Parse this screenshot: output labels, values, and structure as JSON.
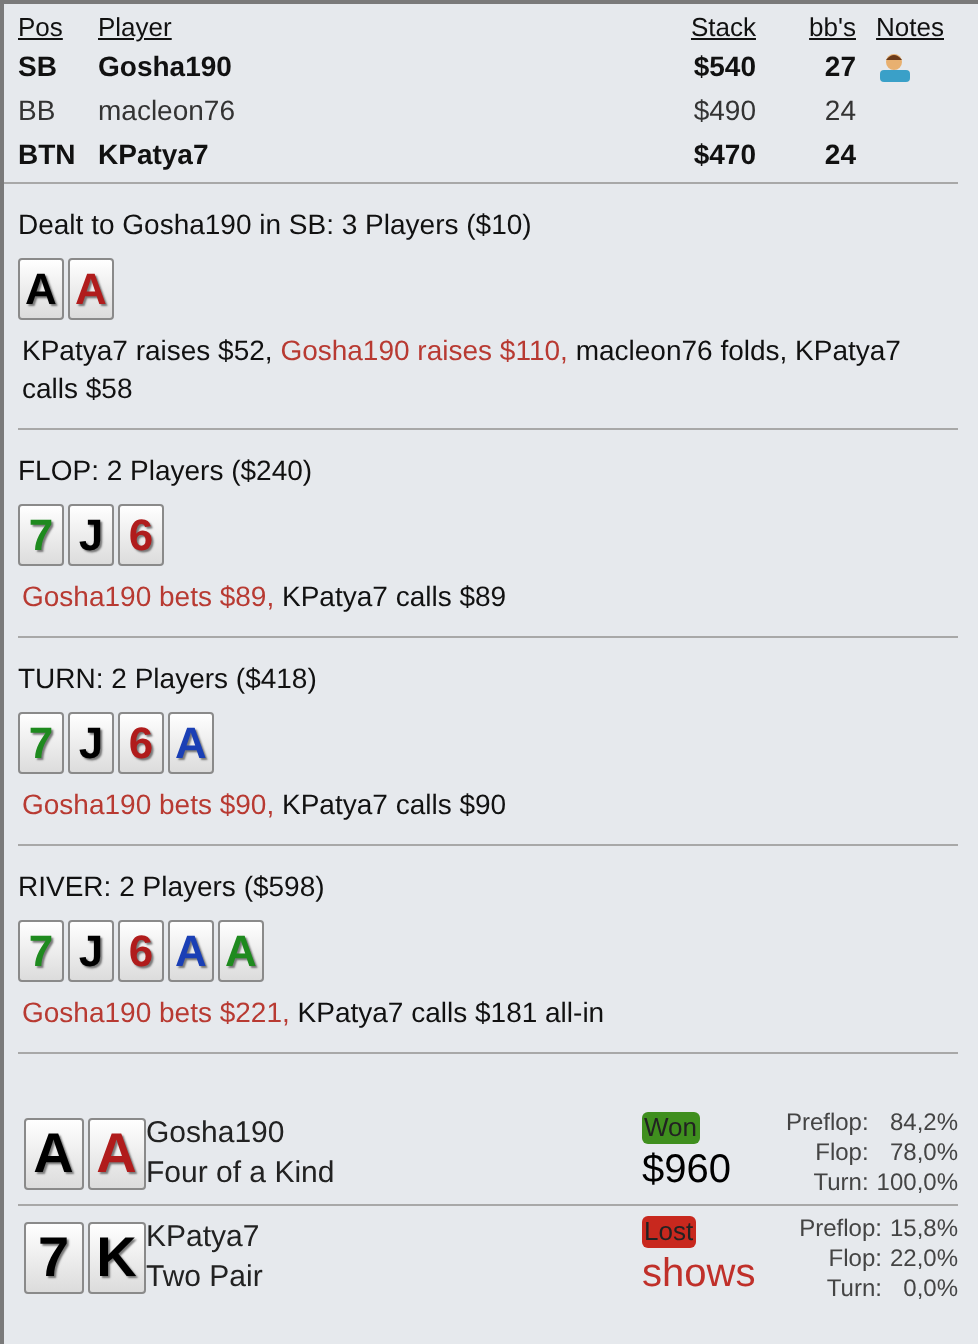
{
  "players_table": {
    "columns": [
      "Pos",
      "Player",
      "Stack",
      "bb's",
      "Notes"
    ],
    "rows": [
      {
        "pos": "SB",
        "player": "Gosha190",
        "stack": "$540",
        "bbs": "27",
        "bold": true,
        "has_note": true
      },
      {
        "pos": "BB",
        "player": "macleon76",
        "stack": "$490",
        "bbs": "24",
        "bold": false,
        "has_note": false
      },
      {
        "pos": "BTN",
        "player": "KPatya7",
        "stack": "$470",
        "bbs": "24",
        "bold": true,
        "has_note": false
      }
    ]
  },
  "streets": [
    {
      "title": "Dealt to Gosha190 in SB: 3 Players ($10)",
      "cards": [
        {
          "rank": "A",
          "color": "#000000"
        },
        {
          "rank": "A",
          "color": "#b01c1c"
        }
      ],
      "actions": [
        {
          "text": "KPatya7 raises $52, ",
          "hero": false
        },
        {
          "text": "Gosha190 raises $110, ",
          "hero": true
        },
        {
          "text": "macleon76 folds, KPatya7 calls $58",
          "hero": false
        }
      ]
    },
    {
      "title": "FLOP: 2 Players ($240)",
      "cards": [
        {
          "rank": "7",
          "color": "#1e8a1e"
        },
        {
          "rank": "J",
          "color": "#000000"
        },
        {
          "rank": "6",
          "color": "#b01c1c"
        }
      ],
      "actions": [
        {
          "text": "Gosha190 bets $89, ",
          "hero": true
        },
        {
          "text": "KPatya7 calls $89",
          "hero": false
        }
      ]
    },
    {
      "title": "TURN: 2 Players ($418)",
      "cards": [
        {
          "rank": "7",
          "color": "#1e8a1e"
        },
        {
          "rank": "J",
          "color": "#000000"
        },
        {
          "rank": "6",
          "color": "#b01c1c"
        },
        {
          "rank": "A",
          "color": "#1a3fb5"
        }
      ],
      "actions": [
        {
          "text": "Gosha190 bets $90, ",
          "hero": true
        },
        {
          "text": "KPatya7 calls $90",
          "hero": false
        }
      ]
    },
    {
      "title": "RIVER: 2 Players ($598)",
      "cards": [
        {
          "rank": "7",
          "color": "#1e8a1e"
        },
        {
          "rank": "J",
          "color": "#000000"
        },
        {
          "rank": "6",
          "color": "#b01c1c"
        },
        {
          "rank": "A",
          "color": "#1a3fb5"
        },
        {
          "rank": "A",
          "color": "#1e8a1e"
        }
      ],
      "actions": [
        {
          "text": "Gosha190 bets $221, ",
          "hero": true
        },
        {
          "text": "KPatya7 calls $181 all-in",
          "hero": false
        }
      ]
    }
  ],
  "showdown": [
    {
      "cards": [
        {
          "rank": "A",
          "color": "#000000"
        },
        {
          "rank": "A",
          "color": "#b01c1c"
        }
      ],
      "player": "Gosha190",
      "hand": "Four of a Kind",
      "kind": "won",
      "badge": "Won",
      "amount": "$960",
      "equity": [
        {
          "label": "Preflop:",
          "value": "84,2%"
        },
        {
          "label": "Flop:",
          "value": "78,0%"
        },
        {
          "label": "Turn:",
          "value": "100,0%"
        }
      ]
    },
    {
      "cards": [
        {
          "rank": "7",
          "color": "#000000"
        },
        {
          "rank": "K",
          "color": "#000000"
        }
      ],
      "player": "KPatya7",
      "hand": "Two Pair",
      "kind": "lost",
      "badge": "Lost",
      "amount": "shows",
      "equity": [
        {
          "label": "Preflop:",
          "value": "15,8%"
        },
        {
          "label": "Flop:",
          "value": "22,0%"
        },
        {
          "label": "Turn:",
          "value": "0,0%"
        }
      ]
    }
  ]
}
